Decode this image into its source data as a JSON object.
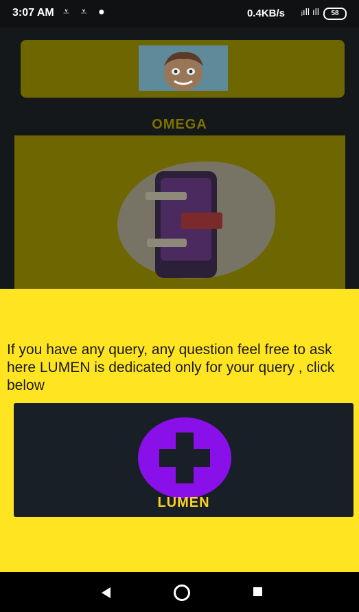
{
  "status_bar": {
    "time": "3:07 AM",
    "left_icons": "⩡ ⩡ ●",
    "network_speed": "0.4KB/s",
    "signal": "ᵢıll ıll",
    "battery": "58"
  },
  "background_app": {
    "title": "OMEGA",
    "avatar_icon": "cartoon-avatar",
    "illustration": "chat-phone-illustration"
  },
  "dialog": {
    "message": "If you have any query, any question feel free to ask here LUMEN is dedicated only for your query , click below",
    "lumen_label": "LUMEN",
    "plus_icon": "plus-circle-icon",
    "colors": {
      "sheet": "#ffe521",
      "card": "#181f27",
      "plus": "#8a10ea",
      "label": "#ffd21f"
    }
  },
  "nav_bar": {
    "back_icon": "back-triangle-icon",
    "home_icon": "home-circle-icon",
    "recents_icon": "recents-square-icon"
  }
}
